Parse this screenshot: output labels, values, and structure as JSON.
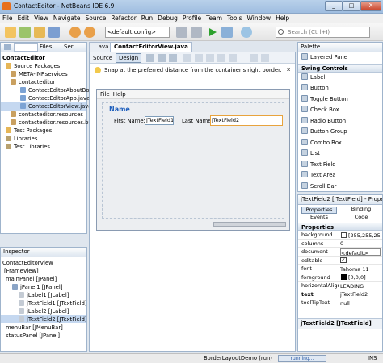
{
  "window": {
    "title": "ContactEditor - NetBeans IDE 6.9",
    "minimize": "_",
    "maximize": "□",
    "close": "X"
  },
  "menu": [
    "File",
    "Edit",
    "View",
    "Navigate",
    "Source",
    "Refactor",
    "Run",
    "Debug",
    "Profile",
    "Team",
    "Tools",
    "Window",
    "Help"
  ],
  "toolbar": {
    "config": "<default config>",
    "search_placeholder": "Search (Ctrl+I)"
  },
  "projects": {
    "tabs": [
      "Files",
      "Ser"
    ],
    "tree": [
      "ContactEditor",
      "Source Packages",
      "META-INF.services",
      "contacteditor",
      "ContactEditorAboutBox.java",
      "ContactEditorApp.java",
      "ContactEditorView.java",
      "contacteditor.resources",
      "contacteditor.resources.busyicons",
      "Test Packages",
      "Libraries",
      "Test Libraries"
    ]
  },
  "inspector": {
    "title": "Inspector",
    "tree": [
      "ContactEditorView",
      "[FrameView]",
      "mainPanel [JPanel]",
      "jPanel1 [JPanel]",
      "jLabel1 [JLabel]",
      "jTextField1 [JTextField]",
      "jLabel2 [JLabel]",
      "jTextField2 [JTextField]",
      "menuBar [JMenuBar]",
      "statusPanel [JPanel]"
    ]
  },
  "editor": {
    "tabs": [
      "...ava",
      "ContactEditorView.java"
    ],
    "source_label": "Source",
    "design_label": "Design",
    "hint": "Snap at the preferred distance from the container's right border.",
    "hint_close": "x",
    "form": {
      "menu": [
        "File",
        "Help"
      ],
      "group_title": "Name",
      "first_name_label": "First Name:",
      "first_name_value": "jTextField1",
      "last_name_label": "Last Name:",
      "last_name_value": "jTextField2"
    }
  },
  "palette": {
    "title": "Palette",
    "items_top": [
      "Layered Pane"
    ],
    "category": "Swing Controls",
    "items": [
      "Label",
      "Button",
      "Toggle Button",
      "Check Box",
      "Radio Button",
      "Button Group",
      "Combo Box",
      "List",
      "Text Field",
      "Text Area",
      "Scroll Bar"
    ]
  },
  "properties": {
    "title": "jTextField2 [JTextField] - Properties",
    "tabs": [
      "Properties",
      "Binding",
      "Events",
      "Code"
    ],
    "section": "Properties",
    "rows": [
      {
        "name": "background",
        "value": "[255,255,255]"
      },
      {
        "name": "columns",
        "value": "0"
      },
      {
        "name": "document",
        "value": "<default>"
      },
      {
        "name": "editable",
        "value": ""
      },
      {
        "name": "font",
        "value": "Tahoma 11"
      },
      {
        "name": "foreground",
        "value": "[0,0,0]"
      },
      {
        "name": "horizontalAlignment",
        "value": "LEADING"
      },
      {
        "name": "text",
        "value": "jTextField2"
      },
      {
        "name": "toolTipText",
        "value": "null"
      }
    ],
    "footer": "jTextField2 [JTextField]"
  },
  "status": {
    "project": "BorderLayoutDemo (run)",
    "progress_text": "running...",
    "mode": "INS"
  },
  "colors": {
    "accent": "#3a77c7",
    "group_title": "#1f5fbd"
  }
}
